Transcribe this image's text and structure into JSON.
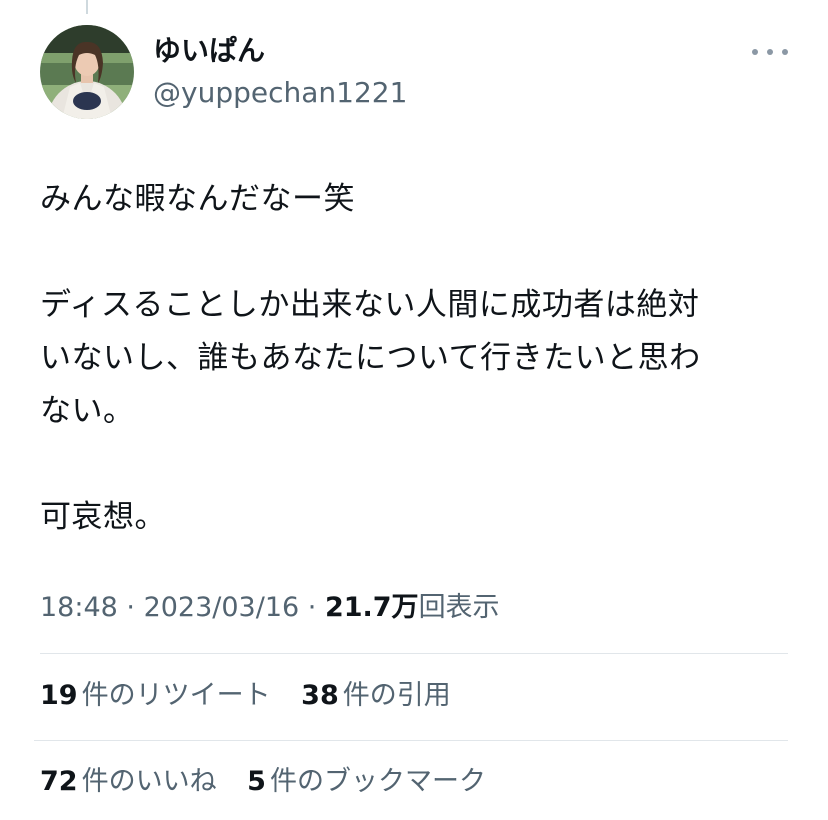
{
  "tweet": {
    "author": {
      "name": "ゆいぱん",
      "handle": "@yuppechan1221"
    },
    "more_icon": "more-horizontal-icon",
    "text_lines": [
      "みんな暇なんだなー笑",
      "",
      "ディスることしか出来ない人間に成功者は絶対",
      "いないし、誰もあなたについて行きたいと思わ",
      "ない。",
      "",
      "可哀想。"
    ],
    "meta": {
      "time": "18:48",
      "separator": " · ",
      "date": "2023/03/16",
      "views_count": "21.7万",
      "views_label": "回表示"
    },
    "stats": {
      "retweets": {
        "count": "19",
        "label": "件のリツイート"
      },
      "quotes": {
        "count": "38",
        "label": "件の引用"
      },
      "likes": {
        "count": "72",
        "label": "件のいいね"
      },
      "bookmarks": {
        "count": "5",
        "label": "件のブックマーク"
      }
    }
  },
  "colors": {
    "text_primary": "#0f1419",
    "text_secondary": "#536471",
    "divider": "#e1e6ea"
  }
}
